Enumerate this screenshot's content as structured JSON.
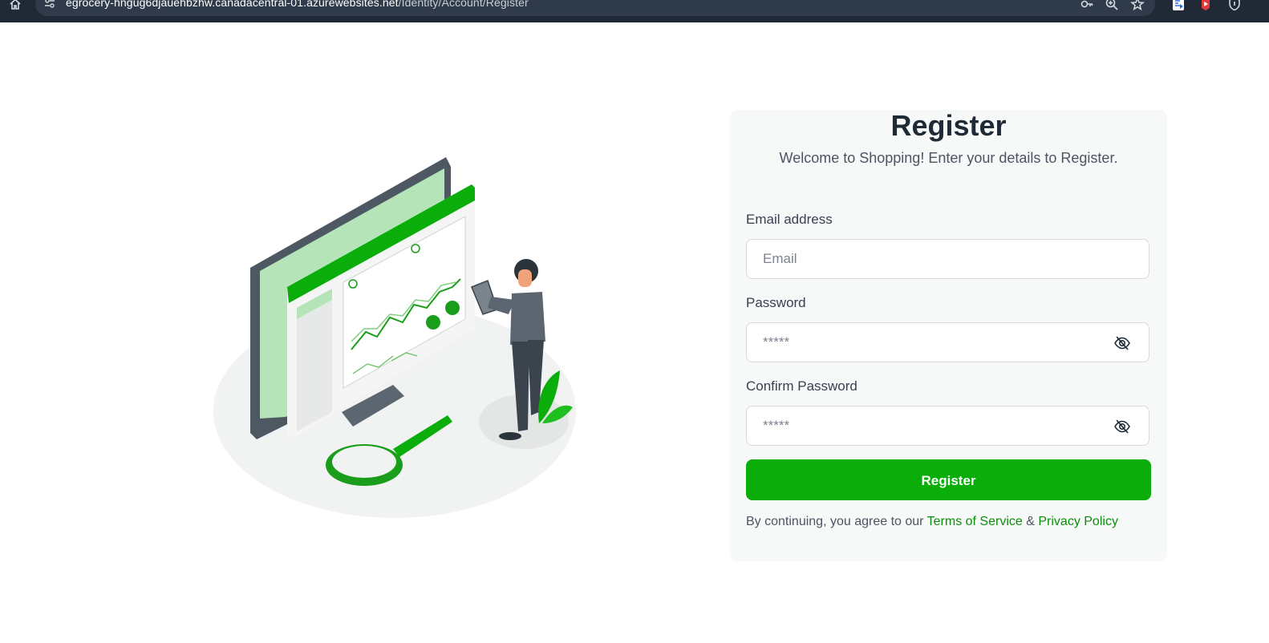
{
  "browser": {
    "url_host": "egrocery-hngug6djauehbzhw.canadacentral-01.azurewebsites.net",
    "url_path": "/Identity/Account/Register",
    "icons": [
      "home-icon",
      "site-info-icon",
      "key-icon",
      "zoom-icon",
      "star-icon",
      "extension-icon",
      "pdf-extension-icon",
      "shield-extension-icon"
    ]
  },
  "register": {
    "title": "Register",
    "subtitle": "Welcome to Shopping! Enter your details to Register.",
    "email_label": "Email address",
    "email_placeholder": "Email",
    "password_label": "Password",
    "password_placeholder": "*****",
    "confirm_label": "Confirm Password",
    "confirm_placeholder": "*****",
    "submit_label": "Register",
    "terms_prefix": "By continuing, you agree to our",
    "terms_link": "Terms of Service",
    "terms_amp": "&",
    "privacy_link": "Privacy Policy"
  },
  "colors": {
    "accent": "#0aad0a",
    "link": "#0a8f0a",
    "card_bg": "#f7f8f8",
    "browser_bar": "#202a36"
  }
}
